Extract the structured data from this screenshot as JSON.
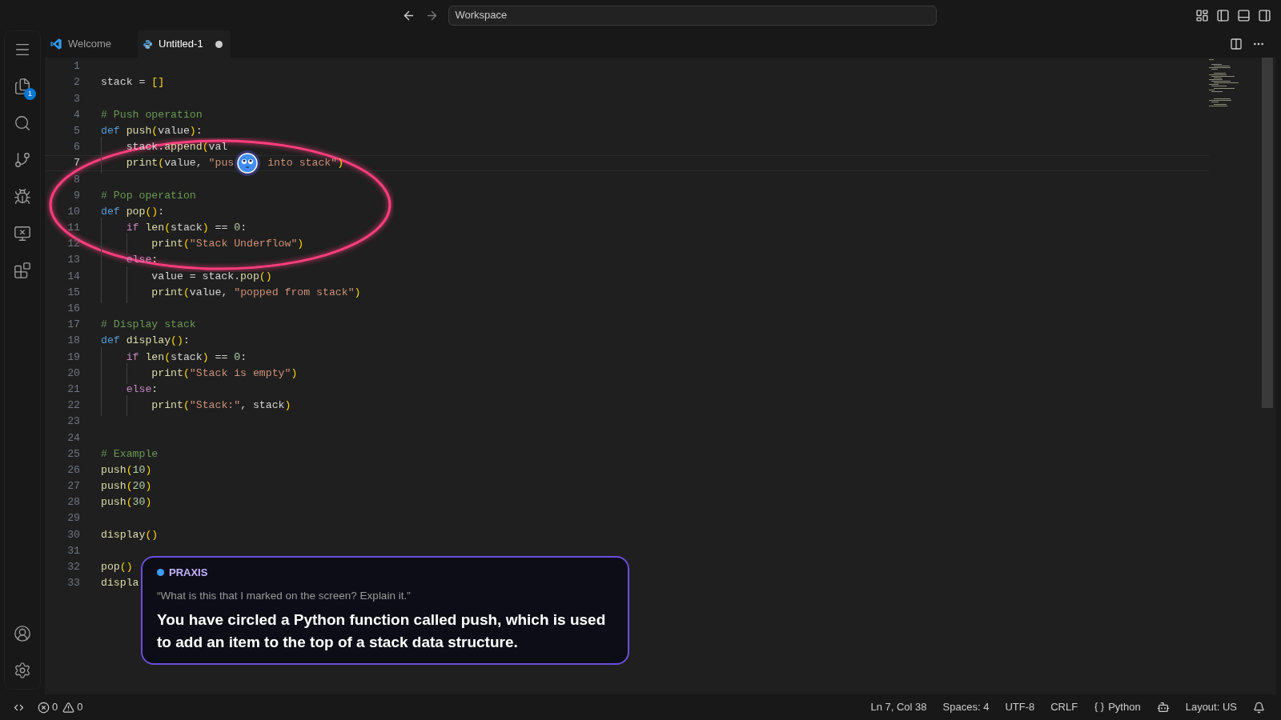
{
  "title_bar": {
    "search": {
      "value": "Workspace"
    }
  },
  "activity_bar": {
    "top": [
      {
        "kind": "menu"
      },
      {
        "kind": "explorer",
        "badge": "1"
      },
      {
        "kind": "search"
      },
      {
        "kind": "source-control"
      },
      {
        "kind": "run-debug"
      },
      {
        "kind": "remote"
      },
      {
        "kind": "extensions"
      }
    ],
    "bottom": [
      {
        "kind": "account"
      },
      {
        "kind": "settings"
      }
    ]
  },
  "tabs": [
    {
      "label": "Welcome",
      "kind": "vscode",
      "selected": false,
      "modified": false
    },
    {
      "label": "Untitled-1",
      "kind": "python",
      "selected": true,
      "modified": true
    }
  ],
  "editor": {
    "lines": [
      {
        "number": "1",
        "current": false
      },
      {
        "number": "2",
        "current": false,
        "tokens": [
          {
            "kind": "plain",
            "text": "stack = "
          },
          {
            "kind": "bracket",
            "text": "[]"
          }
        ]
      },
      {
        "number": "3",
        "current": false
      },
      {
        "number": "4",
        "current": false,
        "tokens": [
          {
            "kind": "comment",
            "text": "# Push operation"
          }
        ]
      },
      {
        "number": "5",
        "current": false,
        "tokens": [
          {
            "kind": "keyword",
            "text": "def"
          },
          {
            "kind": "func",
            "text": " push"
          },
          {
            "kind": "bracket",
            "text": "("
          },
          {
            "kind": "plain",
            "text": "value"
          },
          {
            "kind": "bracket",
            "text": ")"
          },
          {
            "kind": "plain",
            "text": ":"
          }
        ]
      },
      {
        "number": "6",
        "current": false,
        "tokens": [
          {
            "kind": "plain",
            "text": "    stack."
          },
          {
            "kind": "func",
            "text": "append"
          },
          {
            "kind": "bracket",
            "text": "("
          },
          {
            "kind": "plain",
            "text": "val"
          }
        ]
      },
      {
        "number": "7",
        "current": true,
        "tokens": [
          {
            "kind": "func",
            "text": "    print"
          },
          {
            "kind": "bracket",
            "text": "("
          },
          {
            "kind": "plain",
            "text": "value, "
          },
          {
            "kind": "string",
            "text": "\"pus"
          },
          {
            "kind": "mascot"
          },
          {
            "kind": "string",
            "text": " into stack\""
          },
          {
            "kind": "bracket",
            "text": ")"
          }
        ]
      },
      {
        "number": "8",
        "current": false
      },
      {
        "number": "9",
        "current": false,
        "tokens": [
          {
            "kind": "comment",
            "text": "# Pop operation"
          }
        ]
      },
      {
        "number": "10",
        "current": false,
        "tokens": [
          {
            "kind": "keyword",
            "text": "def"
          },
          {
            "kind": "func",
            "text": " pop"
          },
          {
            "kind": "bracket",
            "text": "()"
          },
          {
            "kind": "plain",
            "text": ":"
          }
        ]
      },
      {
        "number": "11",
        "current": false,
        "tokens": [
          {
            "kind": "control",
            "text": "    if"
          },
          {
            "kind": "func",
            "text": " len"
          },
          {
            "kind": "bracket",
            "text": "("
          },
          {
            "kind": "plain",
            "text": "stack"
          },
          {
            "kind": "bracket",
            "text": ")"
          },
          {
            "kind": "plain",
            "text": " == "
          },
          {
            "kind": "number",
            "text": "0"
          },
          {
            "kind": "plain",
            "text": ":"
          }
        ]
      },
      {
        "number": "12",
        "current": false,
        "tokens": [
          {
            "kind": "func",
            "text": "        print"
          },
          {
            "kind": "bracket",
            "text": "("
          },
          {
            "kind": "string",
            "text": "\"Stack Underflow\""
          },
          {
            "kind": "bracket",
            "text": ")"
          }
        ]
      },
      {
        "number": "13",
        "current": false,
        "tokens": [
          {
            "kind": "control",
            "text": "    else"
          },
          {
            "kind": "plain",
            "text": ":"
          }
        ]
      },
      {
        "number": "14",
        "current": false,
        "tokens": [
          {
            "kind": "plain",
            "text": "        value = stack."
          },
          {
            "kind": "func",
            "text": "pop"
          },
          {
            "kind": "bracket",
            "text": "()"
          }
        ]
      },
      {
        "number": "15",
        "current": false,
        "tokens": [
          {
            "kind": "func",
            "text": "        print"
          },
          {
            "kind": "bracket",
            "text": "("
          },
          {
            "kind": "plain",
            "text": "value, "
          },
          {
            "kind": "string",
            "text": "\"popped from stack\""
          },
          {
            "kind": "bracket",
            "text": ")"
          }
        ]
      },
      {
        "number": "16",
        "current": false
      },
      {
        "number": "17",
        "current": false,
        "tokens": [
          {
            "kind": "comment",
            "text": "# Display stack"
          }
        ]
      },
      {
        "number": "18",
        "current": false,
        "tokens": [
          {
            "kind": "keyword",
            "text": "def"
          },
          {
            "kind": "func",
            "text": " display"
          },
          {
            "kind": "bracket",
            "text": "()"
          },
          {
            "kind": "plain",
            "text": ":"
          }
        ]
      },
      {
        "number": "19",
        "current": false,
        "tokens": [
          {
            "kind": "control",
            "text": "    if"
          },
          {
            "kind": "func",
            "text": " len"
          },
          {
            "kind": "bracket",
            "text": "("
          },
          {
            "kind": "plain",
            "text": "stack"
          },
          {
            "kind": "bracket",
            "text": ")"
          },
          {
            "kind": "plain",
            "text": " == "
          },
          {
            "kind": "number",
            "text": "0"
          },
          {
            "kind": "plain",
            "text": ":"
          }
        ]
      },
      {
        "number": "20",
        "current": false,
        "tokens": [
          {
            "kind": "func",
            "text": "        print"
          },
          {
            "kind": "bracket",
            "text": "("
          },
          {
            "kind": "string",
            "text": "\"Stack is empty\""
          },
          {
            "kind": "bracket",
            "text": ")"
          }
        ]
      },
      {
        "number": "21",
        "current": false,
        "tokens": [
          {
            "kind": "control",
            "text": "    else"
          },
          {
            "kind": "plain",
            "text": ":"
          }
        ]
      },
      {
        "number": "22",
        "current": false,
        "tokens": [
          {
            "kind": "func",
            "text": "        print"
          },
          {
            "kind": "bracket",
            "text": "("
          },
          {
            "kind": "string",
            "text": "\"Stack:\""
          },
          {
            "kind": "plain",
            "text": ", stack"
          },
          {
            "kind": "bracket",
            "text": ")"
          }
        ]
      },
      {
        "number": "23",
        "current": false
      },
      {
        "number": "24",
        "current": false
      },
      {
        "number": "25",
        "current": false,
        "tokens": [
          {
            "kind": "comment",
            "text": "# Example"
          }
        ]
      },
      {
        "number": "26",
        "current": false,
        "tokens": [
          {
            "kind": "func",
            "text": "push"
          },
          {
            "kind": "bracket",
            "text": "("
          },
          {
            "kind": "number",
            "text": "10"
          },
          {
            "kind": "bracket",
            "text": ")"
          }
        ]
      },
      {
        "number": "27",
        "current": false,
        "tokens": [
          {
            "kind": "func",
            "text": "push"
          },
          {
            "kind": "bracket",
            "text": "("
          },
          {
            "kind": "number",
            "text": "20"
          },
          {
            "kind": "bracket",
            "text": ")"
          }
        ]
      },
      {
        "number": "28",
        "current": false,
        "tokens": [
          {
            "kind": "func",
            "text": "push"
          },
          {
            "kind": "bracket",
            "text": "("
          },
          {
            "kind": "number",
            "text": "30"
          },
          {
            "kind": "bracket",
            "text": ")"
          }
        ]
      },
      {
        "number": "29",
        "current": false
      },
      {
        "number": "30",
        "current": false,
        "tokens": [
          {
            "kind": "func",
            "text": "display"
          },
          {
            "kind": "bracket",
            "text": "()"
          }
        ]
      },
      {
        "number": "31",
        "current": false
      },
      {
        "number": "32",
        "current": false,
        "tokens": [
          {
            "kind": "func",
            "text": "pop"
          },
          {
            "kind": "bracket",
            "text": "()"
          }
        ]
      },
      {
        "number": "33",
        "current": false,
        "tokens": [
          {
            "kind": "func",
            "text": "displa"
          }
        ]
      }
    ]
  },
  "assistant_popup": {
    "name": "PRAXIS",
    "color": "#3b9eff",
    "question": "“What is this that I marked on the screen? Explain it.”",
    "answer": "You have circled a Python function called push, which is used to add an item to the top of a stack data structure."
  },
  "status_bar": {
    "errors": "0",
    "warnings": "0",
    "items": [
      {
        "kind": "text",
        "text": "Ln 7, Col 38"
      },
      {
        "kind": "text",
        "text": "Spaces: 4"
      },
      {
        "kind": "text",
        "text": "UTF-8"
      },
      {
        "kind": "text",
        "text": "CRLF"
      },
      {
        "kind": "language",
        "text": "Python"
      },
      {
        "kind": "copilot"
      },
      {
        "kind": "text",
        "text": "Layout: US"
      },
      {
        "kind": "bell"
      }
    ]
  }
}
